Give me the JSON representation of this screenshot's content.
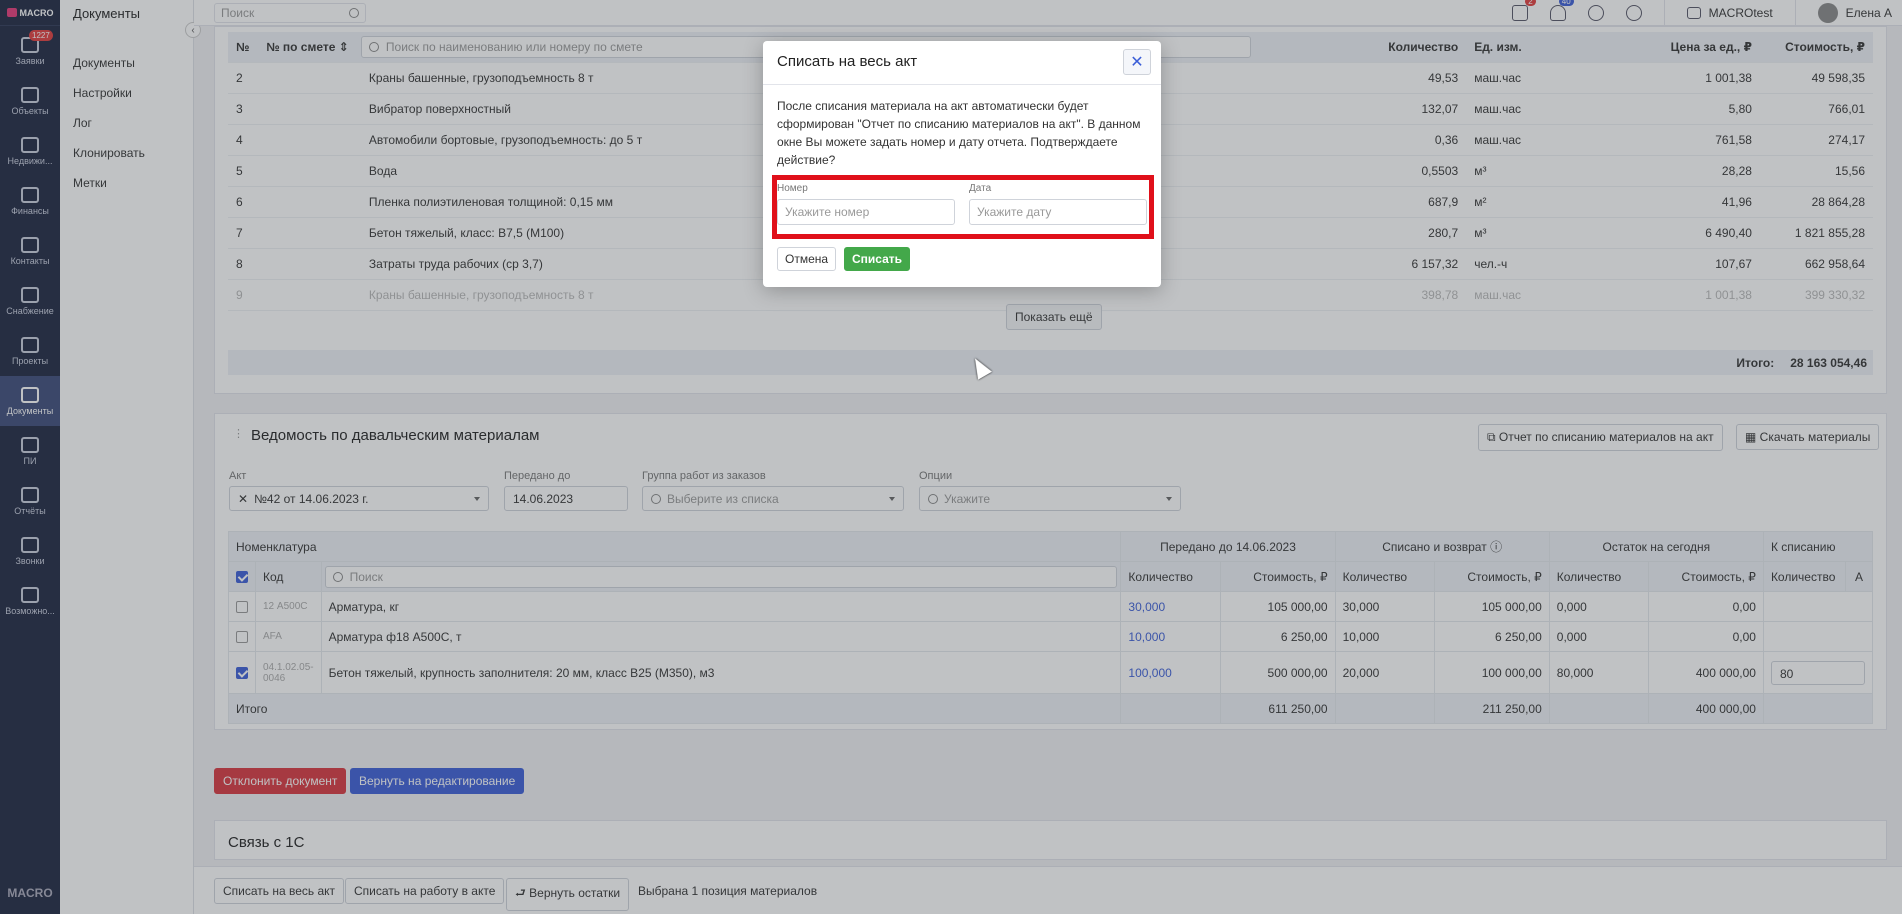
{
  "rail": {
    "logo": "MACRO",
    "items": [
      {
        "label": "Заявки",
        "badge": "1227"
      },
      {
        "label": "Объекты"
      },
      {
        "label": "Недвижи..."
      },
      {
        "label": "Финансы"
      },
      {
        "label": "Контакты"
      },
      {
        "label": "Снабжение"
      },
      {
        "label": "Проекты"
      },
      {
        "label": "Документы"
      },
      {
        "label": "ПИ"
      },
      {
        "label": "Отчёты"
      },
      {
        "label": "Звонки"
      },
      {
        "label": "Возможно..."
      }
    ],
    "brand": "MACRO"
  },
  "subnav": {
    "title": "Документы",
    "links": [
      "Документы",
      "Настройки",
      "Лог",
      "Клонировать",
      "Метки"
    ]
  },
  "topbar": {
    "search_placeholder": "Поиск",
    "calendar_badge": "2",
    "bell_badge": "40",
    "org": "MACROtest",
    "user": "Елена А"
  },
  "estimate": {
    "headers": {
      "n": "№",
      "ref": "№ по смете",
      "search": "Поиск по наименованию или номеру по смете",
      "qty": "Количество",
      "unit": "Ед. изм.",
      "price": "Цена за ед., ₽",
      "cost": "Стоимость, ₽"
    },
    "rows": [
      {
        "n": "2",
        "name": "Краны башенные, грузоподъемность 8 т",
        "qty": "49,53",
        "unit": "маш.час",
        "price": "1 001,38",
        "cost": "49 598,35"
      },
      {
        "n": "3",
        "name": "Вибратор поверхностный",
        "qty": "132,07",
        "unit": "маш.час",
        "price": "5,80",
        "cost": "766,01"
      },
      {
        "n": "4",
        "name": "Автомобили бортовые, грузоподъемность: до 5 т",
        "qty": "0,36",
        "unit": "маш.час",
        "price": "761,58",
        "cost": "274,17"
      },
      {
        "n": "5",
        "name": "Вода",
        "qty": "0,5503",
        "unit": "м³",
        "price": "28,28",
        "cost": "15,56"
      },
      {
        "n": "6",
        "name": "Пленка полиэтиленовая толщиной: 0,15 мм",
        "qty": "687,9",
        "unit": "м²",
        "price": "41,96",
        "cost": "28 864,28"
      },
      {
        "n": "7",
        "name": "Бетон тяжелый, класс: В7,5 (М100)",
        "qty": "280,7",
        "unit": "м³",
        "price": "6 490,40",
        "cost": "1 821 855,28"
      },
      {
        "n": "8",
        "name": "Затраты труда рабочих (ср 3,7)",
        "qty": "6 157,32",
        "unit": "чел.-ч",
        "price": "107,67",
        "cost": "662 958,64"
      },
      {
        "n": "9",
        "name": "Краны башенные, грузоподъемность 8 т",
        "qty": "398,78",
        "unit": "маш.час",
        "price": "1 001,38",
        "cost": "399 330,32"
      }
    ],
    "show_more": "Показать ещё",
    "total_label": "Итого:",
    "total_value": "28 163 054,46"
  },
  "materials": {
    "title": "Ведомость по давальческим материалам",
    "report_button": "Отчет по списанию материалов на акт",
    "download_button": "Скачать материалы",
    "filters": {
      "act_label": "Акт",
      "act_value": "№42 от 14.06.2023 г.",
      "transferred_label": "Передано до",
      "transferred_value": "14.06.2023",
      "group_label": "Группа работ из заказов",
      "group_placeholder": "Выберите из списка",
      "options_label": "Опции",
      "options_placeholder": "Укажите"
    },
    "group_headers": {
      "nomen": "Номенклатура",
      "transferred": "Передано до 14.06.2023",
      "written": "Списано и возврат",
      "remain": "Остаток на сегодня",
      "to_write": "К списанию"
    },
    "col_headers": {
      "code": "Код",
      "search": "Поиск",
      "qty": "Количество",
      "cost": "Стоимость, ₽",
      "a": "А"
    },
    "rows": [
      {
        "checked": false,
        "code": "12 А500С",
        "name": "Арматура, кг",
        "tq": "30,000",
        "tc": "105 000,00",
        "wq": "30,000",
        "wc": "105 000,00",
        "rq": "0,000",
        "rc": "0,00",
        "to": ""
      },
      {
        "checked": false,
        "code": "AFA",
        "name": "Арматура ф18 А500С, т",
        "tq": "10,000",
        "tc": "6 250,00",
        "wq": "10,000",
        "wc": "6 250,00",
        "rq": "0,000",
        "rc": "0,00",
        "to": ""
      },
      {
        "checked": true,
        "code": "04.1.02.05-0046",
        "name": "Бетон тяжелый, крупность заполнителя: 20 мм, класс В25 (М350), м3",
        "tq": "100,000",
        "tc": "500 000,00",
        "wq": "20,000",
        "wc": "100 000,00",
        "rq": "80,000",
        "rc": "400 000,00",
        "to": "80"
      }
    ],
    "total": {
      "label": "Итого",
      "tc": "611 250,00",
      "wc": "211 250,00",
      "rc": "400 000,00"
    }
  },
  "actions": {
    "reject": "Отклонить документ",
    "return_edit": "Вернуть на редактирование"
  },
  "link_1c": "Связь с 1С",
  "bottom_bar": {
    "write_all": "Списать на весь акт",
    "write_work": "Списать на работу в акте",
    "return_rest": "Вернуть остатки",
    "selected": "Выбрана 1 позиция материалов"
  },
  "modal": {
    "title": "Списать на весь акт",
    "text": "После списания материала на акт автоматически будет сформирован \"Отчет по списанию материалов на акт\". В данном окне Вы можете задать номер и дату отчета. Подтверждаете действие?",
    "number_label": "Номер",
    "number_placeholder": "Укажите номер",
    "date_label": "Дата",
    "date_placeholder": "Укажите дату",
    "cancel": "Отмена",
    "confirm": "Списать"
  },
  "colors": {
    "accent": "#3b5ed8",
    "danger": "#d9363e",
    "success": "#43a84a",
    "highlight": "#e0101a",
    "rail": "#1c2540"
  }
}
